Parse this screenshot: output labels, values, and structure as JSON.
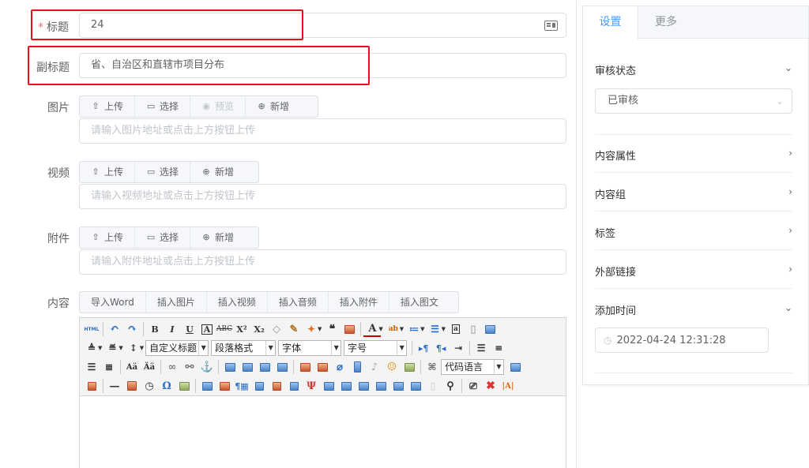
{
  "form": {
    "title_label": "标题",
    "title_required_mark": "*",
    "title_value": "24",
    "subtitle_label": "副标题",
    "subtitle_value": "省、自治区和直辖市项目分布",
    "image_label": "图片",
    "image_buttons": [
      "上传",
      "选择",
      "预览",
      "新增"
    ],
    "image_placeholder": "请输入图片地址或点击上方按钮上传",
    "video_label": "视频",
    "video_buttons": [
      "上传",
      "选择",
      "新增"
    ],
    "video_placeholder": "请输入视频地址或点击上方按钮上传",
    "attachment_label": "附件",
    "attachment_buttons": [
      "上传",
      "选择",
      "新增"
    ],
    "attachment_placeholder": "请输入附件地址或点击上方按钮上传",
    "content_label": "内容",
    "content_buttons": [
      "导入Word",
      "插入图片",
      "插入视频",
      "插入音频",
      "插入附件",
      "插入图文"
    ]
  },
  "editor": {
    "combo_heading": "自定义标题",
    "combo_paragraph": "段落格式",
    "combo_font": "字体",
    "combo_size": "字号",
    "combo_code": "代码语言",
    "html_label": "HTML"
  },
  "sidebar": {
    "tabs": [
      "设置",
      "更多"
    ],
    "review_status_label": "审核状态",
    "review_status_value": "已审核",
    "sections": [
      "内容属性",
      "内容组",
      "标签",
      "外部链接"
    ],
    "add_time_label": "添加时间",
    "add_time_value": "2022-04-24 12:31:28"
  },
  "colors": {
    "accent": "#409eff",
    "highlight_box": "#e8101a",
    "required": "#f56c6c"
  }
}
